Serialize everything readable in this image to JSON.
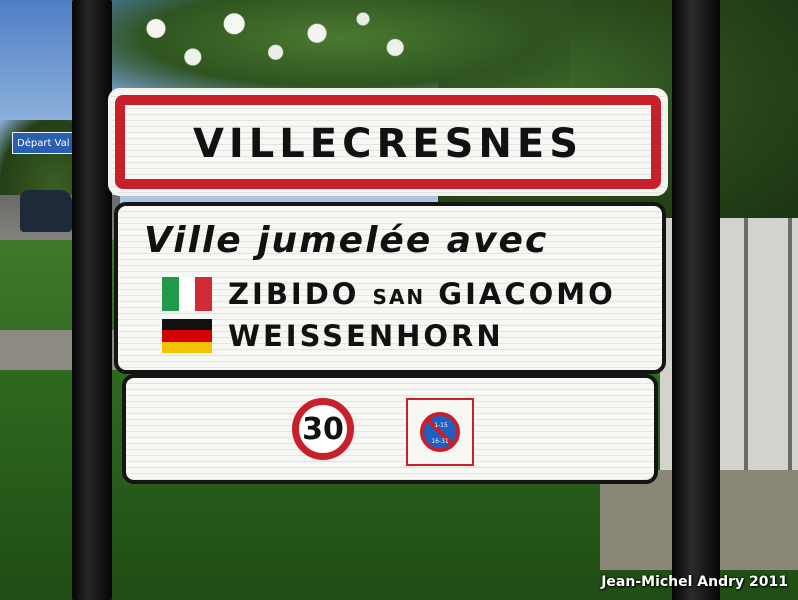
{
  "background_sign": {
    "text": "Départ Val d"
  },
  "town_sign": {
    "name": "VILLECRESNES",
    "border_color": "#c8202a"
  },
  "twin_sign": {
    "heading": "Ville jumelée avec",
    "towns": [
      {
        "flag": "italy-flag",
        "name_part1": "ZIBIDO",
        "name_small": "SAN",
        "name_part2": "GIACOMO"
      },
      {
        "flag": "germany-flag",
        "name": "WEISSENHORN"
      }
    ]
  },
  "limits_sign": {
    "speed_limit": "30",
    "parking_sign": {
      "icon": "no-parking-icon",
      "top_text": "1-15",
      "bottom_text": "16-31"
    }
  },
  "credit": "Jean-Michel Andry 2011",
  "colors": {
    "sign_red": "#c8202a",
    "italy": [
      "#1f9a48",
      "#ffffff",
      "#cf2b37"
    ],
    "germany": [
      "#111111",
      "#d40000",
      "#f3c200"
    ],
    "parking_blue": "#1e5fc0"
  }
}
